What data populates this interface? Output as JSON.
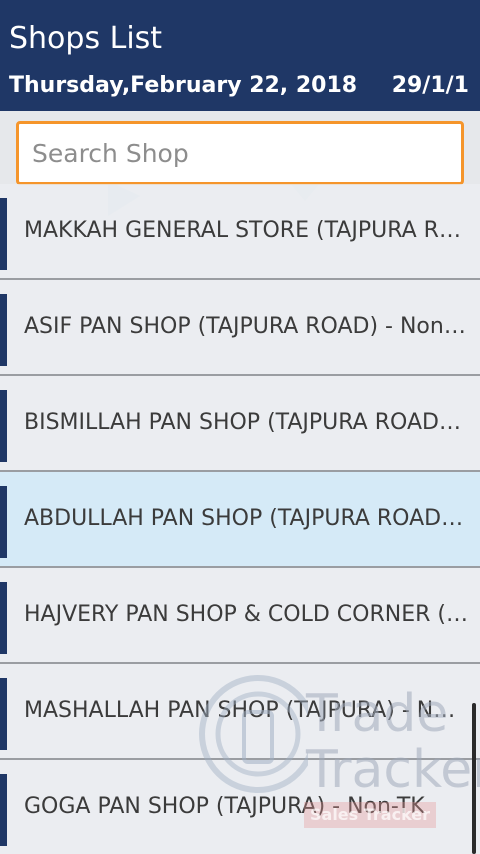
{
  "header": {
    "title": "Shops List",
    "date": "Thursday,February 22, 2018",
    "code": "29/1/1"
  },
  "search": {
    "placeholder": "Search Shop",
    "value": ""
  },
  "shops": [
    {
      "label": "MAKKAH GENERAL STORE (TAJPURA ROAD) - Non-TK",
      "selected": false
    },
    {
      "label": "ASIF PAN SHOP (TAJPURA ROAD) - Non-TK",
      "selected": false
    },
    {
      "label": "BISMILLAH PAN SHOP (TAJPURA ROAD) - Non-TK",
      "selected": false
    },
    {
      "label": "ABDULLAH PAN SHOP (TAJPURA ROAD) - Non-TK",
      "selected": true
    },
    {
      "label": "HAJVERY PAN SHOP & COLD CORNER (TAJPURA) - Non-TK",
      "selected": false
    },
    {
      "label": "MASHALLAH PAN SHOP (TAJPURA) - Non-TK",
      "selected": false
    },
    {
      "label": "GOGA PAN SHOP (TAJPURA) - Non-TK",
      "selected": false
    }
  ],
  "watermark": {
    "line1": "Trade",
    "line2": "Tracker",
    "badge": "Sales Tracker"
  },
  "colors": {
    "header_bg": "#1f3766",
    "search_border": "#f5952b",
    "selected_row": "#d4eaf7",
    "accent_bar": "#1f3766"
  }
}
